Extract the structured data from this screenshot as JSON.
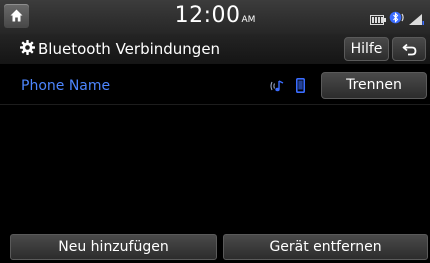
{
  "status": {
    "time": "12:00",
    "ampm": "AM",
    "icons": [
      "battery-icon",
      "bluetooth-audio-icon",
      "signal-icon"
    ]
  },
  "header": {
    "title": "Bluetooth Verbindungen",
    "help_label": "Hilfe",
    "back_icon": "back-arrow-icon",
    "settings_icon": "gear-icon"
  },
  "device": {
    "name": "Phone Name",
    "disconnect_label": "Trennen",
    "name_color": "#4d86ff",
    "accent_color": "#3a6cff"
  },
  "footer": {
    "add_label": "Neu hinzufügen",
    "remove_label": "Gerät entfernen"
  }
}
